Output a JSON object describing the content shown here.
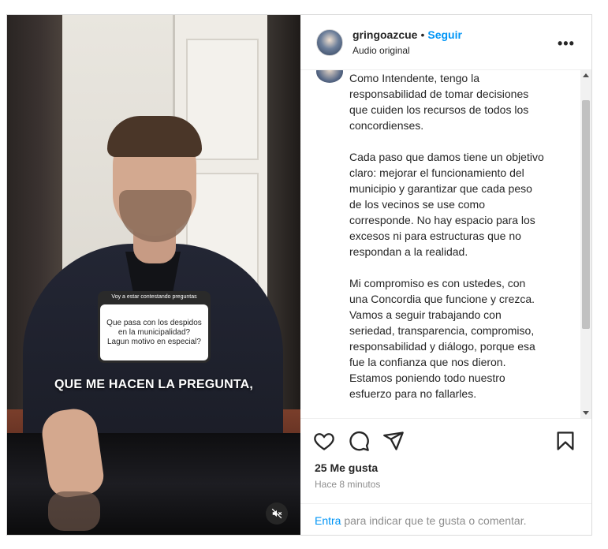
{
  "post": {
    "username": "gringoazcue",
    "dot": "•",
    "follow_label": "Seguir",
    "audio_label": "Audio original",
    "more_label": "•••"
  },
  "video": {
    "sticker_title": "Voy a estar contestando preguntas",
    "sticker_question": "Que pasa con los despidos en la municipalidad? Lagun motivo en especial?",
    "caption": "QUE ME HACEN LA PREGUNTA,",
    "mute_icon": "speaker-muted-icon"
  },
  "description": "Como Intendente, tengo la\nresponsabilidad de tomar decisiones\nque cuiden los recursos de todos los\nconcordienses.\n\nCada paso que damos tiene un objetivo\nclaro: mejorar el funcionamiento del\nmunicipio y garantizar que cada peso\nde los vecinos se use como\ncorresponde. No hay espacio para los\nexcesos ni para estructuras que no\nrespondan a la realidad.\n\nMi compromiso es con ustedes, con\nuna Concordia que funcione y crezca.\nVamos a seguir trabajando con\nseriedad, transparencia, compromiso,\nresponsabilidad y diálogo, porque esa\nfue la confianza que nos dieron.\nEstamos poniendo todo nuestro\nesfuerzo para no fallarles.",
  "stats": {
    "likes": "25 Me gusta",
    "time": "Hace 8 minutos"
  },
  "comment_box": {
    "link": "Entra",
    "text": " para indicar que te gusta o comentar."
  },
  "icons": {
    "like": "heart-icon",
    "comment": "comment-icon",
    "share": "share-icon",
    "save": "bookmark-icon"
  },
  "colors": {
    "link": "#0095f6",
    "text": "#262626",
    "muted": "#8e8e8e"
  }
}
